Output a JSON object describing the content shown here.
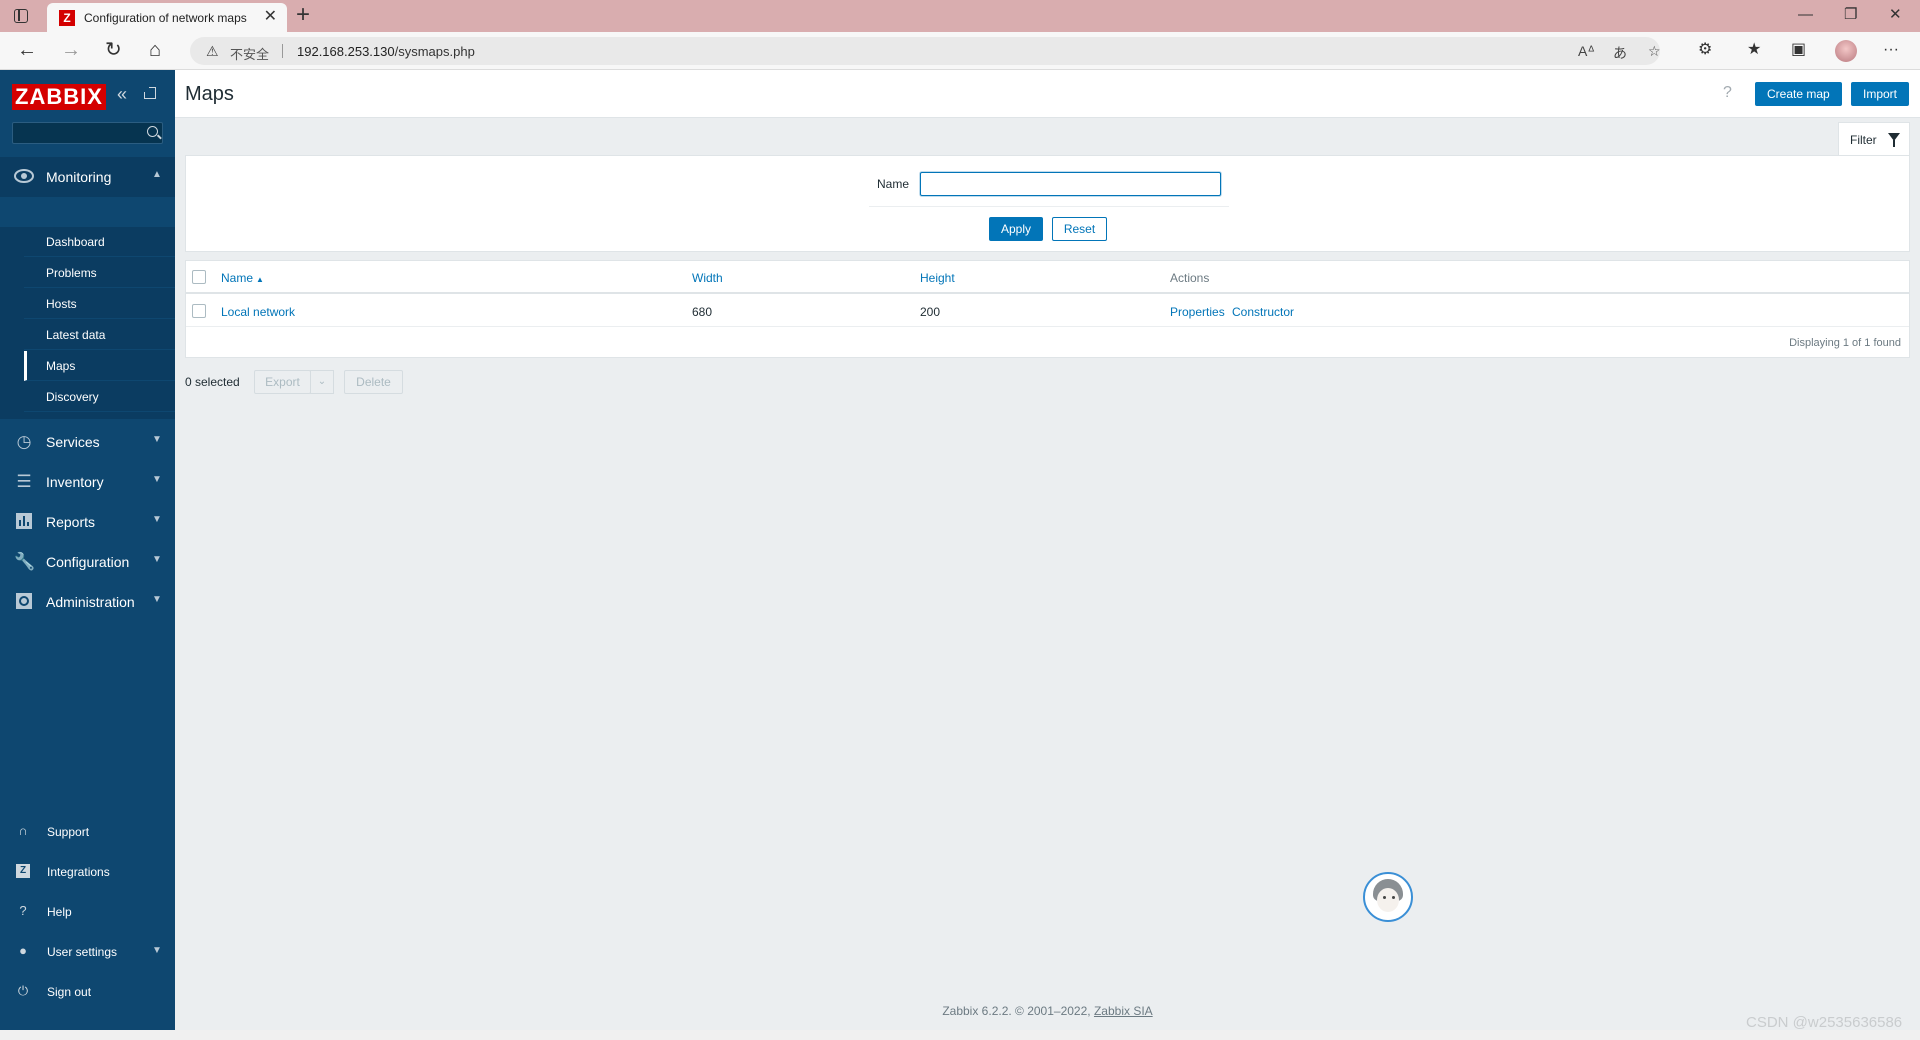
{
  "browser": {
    "tab_title": "Configuration of network maps",
    "tab_favicon_letter": "Z",
    "url_warning": "不安全",
    "url_host": "192.168.253.130",
    "url_path": "/sysmaps.php",
    "icons": [
      "sidebar-toggle-icon",
      "new-tab-icon",
      "back-icon",
      "forward-icon",
      "refresh-icon",
      "home-icon",
      "read-aloud-icon",
      "translate-icon",
      "favorite-icon",
      "extensions-icon",
      "favorites-icon",
      "collections-icon",
      "more-icon"
    ]
  },
  "sidebar": {
    "logo": "ZABBIX",
    "search_placeholder": "",
    "menu": [
      {
        "label": "Monitoring",
        "icon": "eye-icon",
        "expanded": true
      },
      {
        "label": "Services",
        "icon": "clock-icon"
      },
      {
        "label": "Inventory",
        "icon": "list-icon"
      },
      {
        "label": "Reports",
        "icon": "bar-chart-icon"
      },
      {
        "label": "Configuration",
        "icon": "wrench-icon"
      },
      {
        "label": "Administration",
        "icon": "gear-icon"
      }
    ],
    "monitoring_items": [
      "Dashboard",
      "Problems",
      "Hosts",
      "Latest data",
      "Maps",
      "Discovery"
    ],
    "active_item": "Maps",
    "bottom": [
      {
        "label": "Support",
        "icon": "headset-icon"
      },
      {
        "label": "Integrations",
        "icon": "zabbix-z-icon"
      },
      {
        "label": "Help",
        "icon": "question-icon"
      },
      {
        "label": "User settings",
        "icon": "user-icon"
      },
      {
        "label": "Sign out",
        "icon": "power-icon"
      }
    ],
    "colors": {
      "background": "#0e4770",
      "active": "#0b3c61",
      "logo": "#d40000"
    }
  },
  "header": {
    "title": "Maps",
    "help": "?",
    "create_button": "Create map",
    "import_button": "Import"
  },
  "filter": {
    "tab_label": "Filter",
    "name_label": "Name",
    "name_value": "",
    "apply": "Apply",
    "reset": "Reset"
  },
  "table": {
    "columns": [
      "Name",
      "Width",
      "Height",
      "Actions"
    ],
    "sort_column": "Name",
    "rows": [
      {
        "name": "Local network",
        "width": "680",
        "height": "200",
        "actions": [
          "Properties",
          "Constructor"
        ]
      }
    ],
    "footer": "Displaying 1 of 1 found"
  },
  "actions_bar": {
    "selected": "0 selected",
    "export": "Export",
    "delete": "Delete"
  },
  "footer": {
    "text": "Zabbix 6.2.2. © 2001–2022,",
    "link": "Zabbix SIA"
  },
  "watermark": "CSDN @w2535636586",
  "accent_color": "#0275b8"
}
